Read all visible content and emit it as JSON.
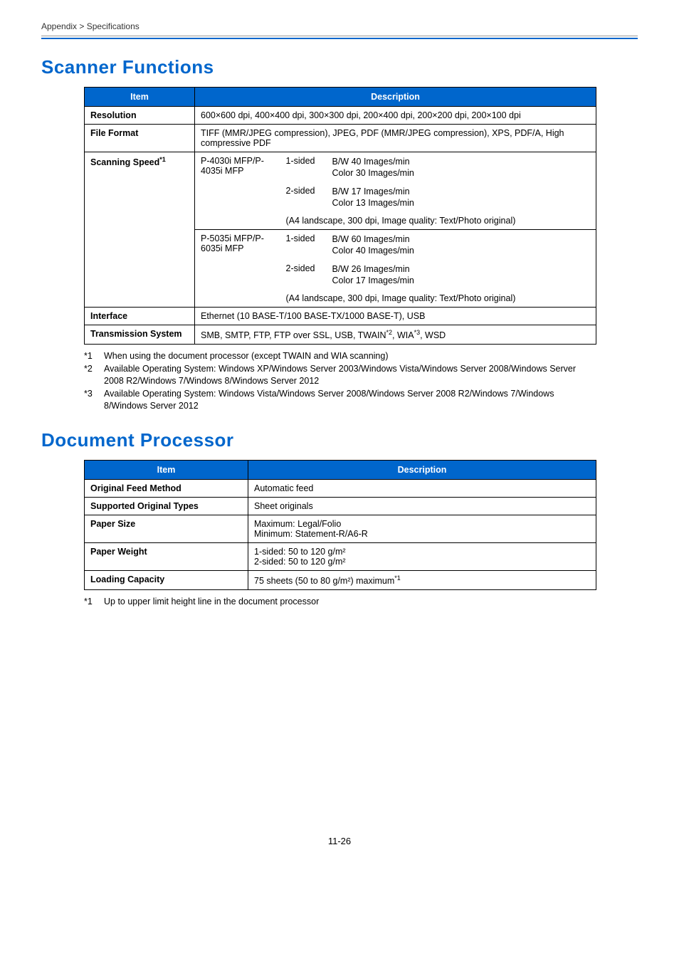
{
  "breadcrumb": "Appendix > Specifications",
  "scanner": {
    "title": "Scanner Functions",
    "headers": {
      "item": "Item",
      "description": "Description"
    },
    "resolution": {
      "label": "Resolution",
      "value": "600×600 dpi, 400×400 dpi, 300×300 dpi, 200×400 dpi, 200×200 dpi, 200×100 dpi"
    },
    "fileformat": {
      "label": "File Format",
      "value": "TIFF (MMR/JPEG compression), JPEG, PDF (MMR/JPEG compression), XPS, PDF/A, High compressive PDF"
    },
    "scanspeed": {
      "label": "Scanning Speed",
      "labelSup": "*1",
      "groupA": {
        "model": "P-4030i MFP/P-4035i MFP",
        "s1label": "1-sided",
        "s1l1": "B/W 40 Images/min",
        "s1l2": "Color 30 Images/min",
        "s2label": "2-sided",
        "s2l1": "B/W 17 Images/min",
        "s2l2": "Color 13 Images/min",
        "meta": "(A4 landscape, 300 dpi, Image quality: Text/Photo original)"
      },
      "groupB": {
        "model": "P-5035i MFP/P-6035i MFP",
        "s1label": "1-sided",
        "s1l1": "B/W 60 Images/min",
        "s1l2": "Color 40 Images/min",
        "s2label": "2-sided",
        "s2l1": "B/W 26 Images/min",
        "s2l2": "Color 17 Images/min",
        "meta": "(A4 landscape, 300 dpi, Image quality: Text/Photo original)"
      }
    },
    "interface": {
      "label": "Interface",
      "value": "Ethernet (10 BASE-T/100 BASE-TX/1000 BASE-T), USB"
    },
    "transmission": {
      "label": "Transmission System",
      "pre": "SMB, SMTP, FTP, FTP over SSL, USB, TWAIN",
      "sup2": "*2",
      "mid": ", WIA",
      "sup3": "*3",
      "post": ", WSD"
    },
    "footnotes": {
      "f1m": "*1",
      "f1": "When using the document processor (except TWAIN and WIA scanning)",
      "f2m": "*2",
      "f2": "Available Operating System: Windows XP/Windows Server 2003/Windows Vista/Windows Server 2008/Windows Server 2008 R2/Windows 7/Windows 8/Windows Server 2012",
      "f3m": "*3",
      "f3": "Available Operating System: Windows Vista/Windows Server 2008/Windows Server 2008 R2/Windows 7/Windows 8/Windows Server 2012"
    }
  },
  "dp": {
    "title": "Document Processor",
    "headers": {
      "item": "Item",
      "description": "Description"
    },
    "r1": {
      "label": "Original Feed Method",
      "value": "Automatic feed"
    },
    "r2": {
      "label": "Supported Original Types",
      "value": "Sheet originals"
    },
    "r3": {
      "label": "Paper Size",
      "l1": "Maximum: Legal/Folio",
      "l2": "Minimum: Statement-R/A6-R"
    },
    "r4": {
      "label": "Paper Weight",
      "l1": "1-sided: 50 to 120 g/m²",
      "l2": "2-sided: 50 to 120 g/m²"
    },
    "r5": {
      "label": "Loading Capacity",
      "value": "75 sheets (50 to 80 g/m²) maximum",
      "sup": "*1"
    },
    "footnotes": {
      "f1m": "*1",
      "f1": "Up to upper limit height line in the document processor"
    }
  },
  "pageNumber": "11-26"
}
